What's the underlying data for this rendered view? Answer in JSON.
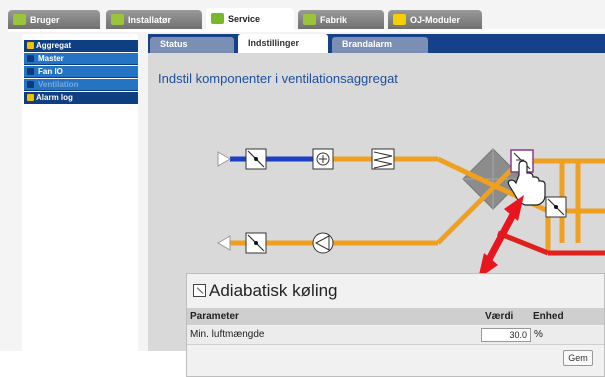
{
  "top_tabs": [
    {
      "label": "Bruger"
    },
    {
      "label": "Installatør"
    },
    {
      "label": "Service"
    },
    {
      "label": "Fabrik"
    },
    {
      "label": "OJ-Moduler"
    }
  ],
  "left_nav": [
    {
      "label": "Aggregat"
    },
    {
      "label": "Master"
    },
    {
      "label": "Fan IO"
    },
    {
      "label": "Ventilation"
    },
    {
      "label": "Alarm log"
    }
  ],
  "sub_tabs": [
    {
      "label": "Status"
    },
    {
      "label": "Indstillinger"
    },
    {
      "label": "Brandalarm"
    }
  ],
  "page_title": "Indstil komponenter i ventilationsaggregat",
  "detail": {
    "title": "Adiabatisk køling",
    "col_parameter": "Parameter",
    "col_value": "Værdi",
    "col_unit": "Enhed",
    "rows": [
      {
        "name": "Min. luftmængde",
        "value": "30.0",
        "unit": "%"
      }
    ],
    "save_label": "Gem"
  },
  "colors": {
    "supply_duct": "#1a3fc4",
    "orange_duct": "#f0a020",
    "red_duct": "#e0201a",
    "exchanger": "#8c8c8c",
    "arrow": "#e8141e",
    "nav_blue": "#2a78c8"
  }
}
